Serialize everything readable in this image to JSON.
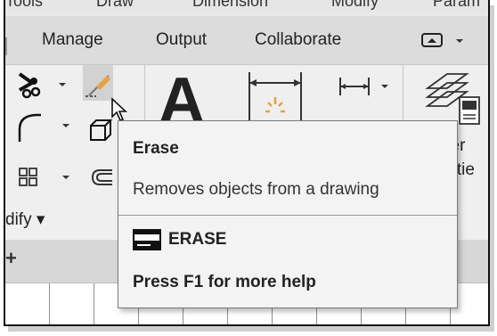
{
  "menubar": {
    "items": [
      "Tools",
      "Draw",
      "Dimension",
      "Modify",
      "Param"
    ]
  },
  "tabs": [
    "Manage",
    "Output",
    "Collaborate"
  ],
  "panel": {
    "modify_label": "dify ▾",
    "layer_text1": "yer",
    "layer_text2": "ertie"
  },
  "tooltip": {
    "title": "Erase",
    "description": "Removes objects from a drawing",
    "command": "ERASE",
    "help": "Press F1 for more help"
  },
  "icons": [
    "scissors-icon",
    "erase-icon",
    "cursor-icon",
    "fillet-icon",
    "cube-icon",
    "array-icon",
    "offset-icon",
    "text-icon",
    "dimension-icon",
    "linear-dim-icon",
    "layers-icon",
    "command-line-icon",
    "view-toggle-icon",
    "new-tab-icon"
  ],
  "colors": {
    "accent_orange": "#e8a23a",
    "tooltip_bg": "#f3f3f3",
    "ribbon_bg": "#efefef"
  }
}
